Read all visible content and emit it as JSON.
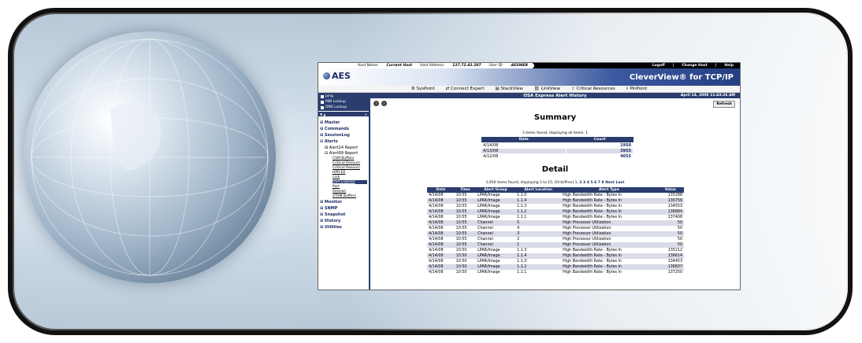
{
  "topbar": {
    "host_label": "Host Name:",
    "host_value": "Current Host",
    "addr_label": "Host Address:",
    "addr_value": "137.72.43.207",
    "user_label": "User ID:",
    "user_value": "AESWEB",
    "links": [
      "Logoff",
      "|",
      "Change Host",
      "|",
      "Help"
    ]
  },
  "banner": {
    "logo": "AES",
    "product": "CleverView® for TCP/IP"
  },
  "toolbar": [
    "SysPoint",
    "Connect Expert",
    "StackView",
    "LinkView",
    "Critical Resources",
    "PinPoint"
  ],
  "quick_links": [
    "ping",
    "MIB Lookup",
    "DNS Lookup"
  ],
  "tree": [
    {
      "t": "n",
      "label": "Master"
    },
    {
      "t": "n",
      "label": "Commands"
    },
    {
      "t": "n",
      "label": "SessionLog"
    },
    {
      "t": "n",
      "label": "Alerts"
    },
    {
      "t": "s",
      "label": "Alert24 Report"
    },
    {
      "t": "s",
      "label": "Alert99 Report"
    },
    {
      "t": "l",
      "label": "CSM Buffers"
    },
    {
      "t": "l",
      "label": "Critical Resourc"
    },
    {
      "t": "l",
      "label": "Critical Resourc"
    },
    {
      "t": "l",
      "label": "HPR-EE"
    },
    {
      "t": "l",
      "label": "Link"
    },
    {
      "t": "l",
      "label": "OSA Express",
      "selected": true
    },
    {
      "t": "l",
      "label": "Port"
    },
    {
      "t": "l",
      "label": "Session"
    },
    {
      "t": "l",
      "label": "VTAM Buffers"
    },
    {
      "t": "n",
      "label": "Monitor"
    },
    {
      "t": "n",
      "label": "SNMP"
    },
    {
      "t": "n",
      "label": "Snapshot"
    },
    {
      "t": "n",
      "label": "History"
    },
    {
      "t": "n",
      "label": "Utilities"
    }
  ],
  "page": {
    "title": "OSA Express Alert History",
    "date": "April 14, 2008 11:43:26 AM",
    "refresh": "Refresh"
  },
  "summary": {
    "heading": "Summary",
    "caption": "3 items found, displaying all items. 1",
    "headers": [
      "Date",
      "Count"
    ],
    "rows": [
      [
        "4/14/08",
        "1950"
      ],
      [
        "4/13/08",
        "3955"
      ],
      [
        "4/12/08",
        "4055"
      ]
    ]
  },
  "detail": {
    "heading": "Detail",
    "caption": "1,950 items found, displaying 1 to 15. [First/Prev] 1,",
    "pages": "2 3 4 5 6 7 8 Next Last",
    "headers": [
      "Date",
      "Time",
      "Alert Group",
      "Alert Location",
      "Alert Type",
      "Value"
    ],
    "rows": [
      [
        "4/14/08",
        "10:55",
        "LPAR/Image",
        "1.1.5",
        "High Bandwidth Rate - Bytes In",
        "135288"
      ],
      [
        "4/14/08",
        "10:55",
        "LPAR/Image",
        "1.1.4",
        "High Bandwidth Rate - Bytes In",
        "136756"
      ],
      [
        "4/14/08",
        "10:55",
        "LPAR/Image",
        "1.1.3",
        "High Bandwidth Rate - Bytes In",
        "134553"
      ],
      [
        "4/14/08",
        "10:55",
        "LPAR/Image",
        "1.1.2",
        "High Bandwidth Rate - Bytes In",
        "136884"
      ],
      [
        "4/14/08",
        "10:55",
        "LPAR/Image",
        "1.1.1",
        "High Bandwidth Rate - Bytes In",
        "137408"
      ],
      [
        "4/14/08",
        "10:55",
        "Channel",
        "5",
        "High Processor Utilization",
        "50"
      ],
      [
        "4/14/08",
        "10:55",
        "Channel",
        "4",
        "High Processor Utilization",
        "50"
      ],
      [
        "4/14/08",
        "10:55",
        "Channel",
        "3",
        "High Processor Utilization",
        "50"
      ],
      [
        "4/14/08",
        "10:55",
        "Channel",
        "2",
        "High Processor Utilization",
        "50"
      ],
      [
        "4/14/08",
        "10:55",
        "Channel",
        "1",
        "High Processor Utilization",
        "50"
      ],
      [
        "4/14/08",
        "10:50",
        "LPAR/Image",
        "1.1.3",
        "High Bandwidth Rate - Bytes In",
        "135212"
      ],
      [
        "4/14/08",
        "10:50",
        "LPAR/Image",
        "1.1.4",
        "High Bandwidth Rate - Bytes In",
        "136614"
      ],
      [
        "4/14/08",
        "10:50",
        "LPAR/Image",
        "1.1.3",
        "High Bandwidth Rate - Bytes In",
        "134453"
      ],
      [
        "4/14/08",
        "10:50",
        "LPAR/Image",
        "1.1.2",
        "High Bandwidth Rate - Bytes In",
        "136837"
      ],
      [
        "4/14/08",
        "10:50",
        "LPAR/Image",
        "1.1.1",
        "High Bandwidth Rate - Bytes In",
        "137250"
      ]
    ]
  }
}
